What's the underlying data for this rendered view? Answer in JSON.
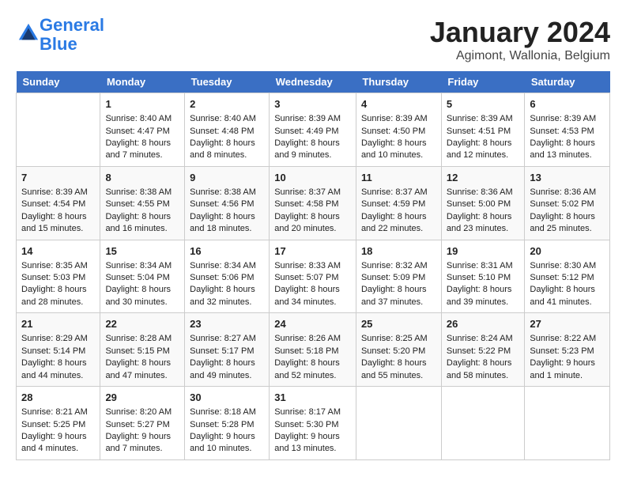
{
  "header": {
    "logo_line1": "General",
    "logo_line2": "Blue",
    "month_title": "January 2024",
    "subtitle": "Agimont, Wallonia, Belgium"
  },
  "days_of_week": [
    "Sunday",
    "Monday",
    "Tuesday",
    "Wednesday",
    "Thursday",
    "Friday",
    "Saturday"
  ],
  "weeks": [
    [
      {
        "day": "",
        "content": ""
      },
      {
        "day": "1",
        "content": "Sunrise: 8:40 AM\nSunset: 4:47 PM\nDaylight: 8 hours\nand 7 minutes."
      },
      {
        "day": "2",
        "content": "Sunrise: 8:40 AM\nSunset: 4:48 PM\nDaylight: 8 hours\nand 8 minutes."
      },
      {
        "day": "3",
        "content": "Sunrise: 8:39 AM\nSunset: 4:49 PM\nDaylight: 8 hours\nand 9 minutes."
      },
      {
        "day": "4",
        "content": "Sunrise: 8:39 AM\nSunset: 4:50 PM\nDaylight: 8 hours\nand 10 minutes."
      },
      {
        "day": "5",
        "content": "Sunrise: 8:39 AM\nSunset: 4:51 PM\nDaylight: 8 hours\nand 12 minutes."
      },
      {
        "day": "6",
        "content": "Sunrise: 8:39 AM\nSunset: 4:53 PM\nDaylight: 8 hours\nand 13 minutes."
      }
    ],
    [
      {
        "day": "7",
        "content": "Sunrise: 8:39 AM\nSunset: 4:54 PM\nDaylight: 8 hours\nand 15 minutes."
      },
      {
        "day": "8",
        "content": "Sunrise: 8:38 AM\nSunset: 4:55 PM\nDaylight: 8 hours\nand 16 minutes."
      },
      {
        "day": "9",
        "content": "Sunrise: 8:38 AM\nSunset: 4:56 PM\nDaylight: 8 hours\nand 18 minutes."
      },
      {
        "day": "10",
        "content": "Sunrise: 8:37 AM\nSunset: 4:58 PM\nDaylight: 8 hours\nand 20 minutes."
      },
      {
        "day": "11",
        "content": "Sunrise: 8:37 AM\nSunset: 4:59 PM\nDaylight: 8 hours\nand 22 minutes."
      },
      {
        "day": "12",
        "content": "Sunrise: 8:36 AM\nSunset: 5:00 PM\nDaylight: 8 hours\nand 23 minutes."
      },
      {
        "day": "13",
        "content": "Sunrise: 8:36 AM\nSunset: 5:02 PM\nDaylight: 8 hours\nand 25 minutes."
      }
    ],
    [
      {
        "day": "14",
        "content": "Sunrise: 8:35 AM\nSunset: 5:03 PM\nDaylight: 8 hours\nand 28 minutes."
      },
      {
        "day": "15",
        "content": "Sunrise: 8:34 AM\nSunset: 5:04 PM\nDaylight: 8 hours\nand 30 minutes."
      },
      {
        "day": "16",
        "content": "Sunrise: 8:34 AM\nSunset: 5:06 PM\nDaylight: 8 hours\nand 32 minutes."
      },
      {
        "day": "17",
        "content": "Sunrise: 8:33 AM\nSunset: 5:07 PM\nDaylight: 8 hours\nand 34 minutes."
      },
      {
        "day": "18",
        "content": "Sunrise: 8:32 AM\nSunset: 5:09 PM\nDaylight: 8 hours\nand 37 minutes."
      },
      {
        "day": "19",
        "content": "Sunrise: 8:31 AM\nSunset: 5:10 PM\nDaylight: 8 hours\nand 39 minutes."
      },
      {
        "day": "20",
        "content": "Sunrise: 8:30 AM\nSunset: 5:12 PM\nDaylight: 8 hours\nand 41 minutes."
      }
    ],
    [
      {
        "day": "21",
        "content": "Sunrise: 8:29 AM\nSunset: 5:14 PM\nDaylight: 8 hours\nand 44 minutes."
      },
      {
        "day": "22",
        "content": "Sunrise: 8:28 AM\nSunset: 5:15 PM\nDaylight: 8 hours\nand 47 minutes."
      },
      {
        "day": "23",
        "content": "Sunrise: 8:27 AM\nSunset: 5:17 PM\nDaylight: 8 hours\nand 49 minutes."
      },
      {
        "day": "24",
        "content": "Sunrise: 8:26 AM\nSunset: 5:18 PM\nDaylight: 8 hours\nand 52 minutes."
      },
      {
        "day": "25",
        "content": "Sunrise: 8:25 AM\nSunset: 5:20 PM\nDaylight: 8 hours\nand 55 minutes."
      },
      {
        "day": "26",
        "content": "Sunrise: 8:24 AM\nSunset: 5:22 PM\nDaylight: 8 hours\nand 58 minutes."
      },
      {
        "day": "27",
        "content": "Sunrise: 8:22 AM\nSunset: 5:23 PM\nDaylight: 9 hours\nand 1 minute."
      }
    ],
    [
      {
        "day": "28",
        "content": "Sunrise: 8:21 AM\nSunset: 5:25 PM\nDaylight: 9 hours\nand 4 minutes."
      },
      {
        "day": "29",
        "content": "Sunrise: 8:20 AM\nSunset: 5:27 PM\nDaylight: 9 hours\nand 7 minutes."
      },
      {
        "day": "30",
        "content": "Sunrise: 8:18 AM\nSunset: 5:28 PM\nDaylight: 9 hours\nand 10 minutes."
      },
      {
        "day": "31",
        "content": "Sunrise: 8:17 AM\nSunset: 5:30 PM\nDaylight: 9 hours\nand 13 minutes."
      },
      {
        "day": "",
        "content": ""
      },
      {
        "day": "",
        "content": ""
      },
      {
        "day": "",
        "content": ""
      }
    ]
  ]
}
